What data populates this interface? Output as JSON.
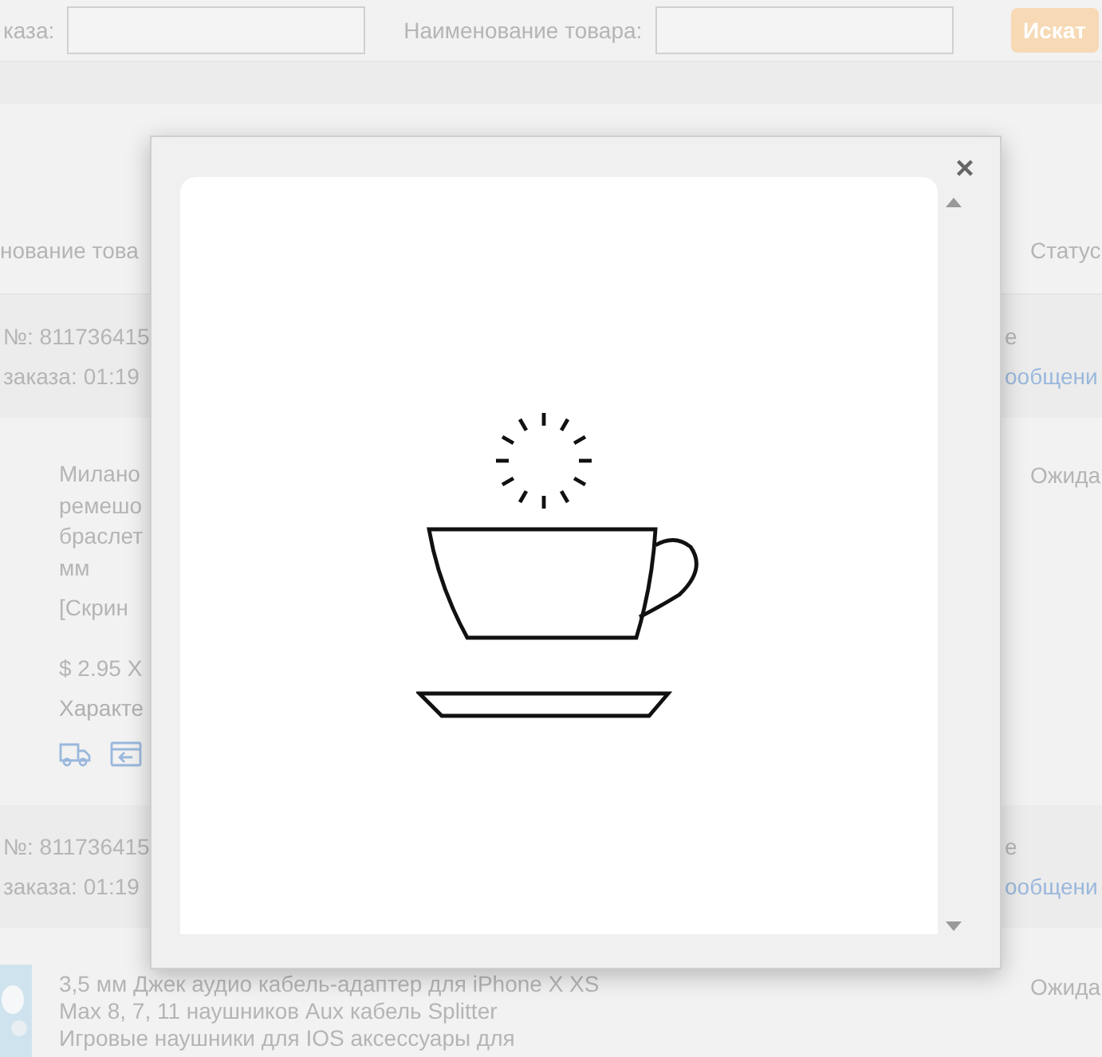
{
  "search_bar": {
    "fields": [
      {
        "label": "каза:"
      },
      {
        "label": "Наименование товара:"
      }
    ],
    "button": "Искат"
  },
  "table": {
    "columns": [
      "нование това",
      "Статус"
    ],
    "orders": [
      {
        "number": "№: 811736415",
        "time_label": "заказа:",
        "time": "01:19",
        "right_text": "е",
        "message_link": "ообщени",
        "item": {
          "thumbnail": false,
          "lines": [
            "Милано",
            "ремешо",
            "браслет",
            "мм"
          ],
          "screenshot": "[Скрин",
          "price": "$ 2.95 X",
          "specs": "Характе",
          "status": "Ожида",
          "icons": true
        }
      },
      {
        "number": "№: 811736415",
        "time_label": "заказа:",
        "time": "01:19",
        "right_text": "е",
        "message_link": "ообщени",
        "item": {
          "thumbnail": true,
          "lines": [
            "3,5 мм Джек аудио кабель-адаптер для iPhone X XS",
            "Max 8, 7, 11 наушников Aux кабель Splitter",
            "Игровые наушники для IOS аксессуары для"
          ],
          "status": "Ожида",
          "icons": false
        }
      }
    ]
  },
  "modal": {
    "close": "×",
    "loading": true
  }
}
